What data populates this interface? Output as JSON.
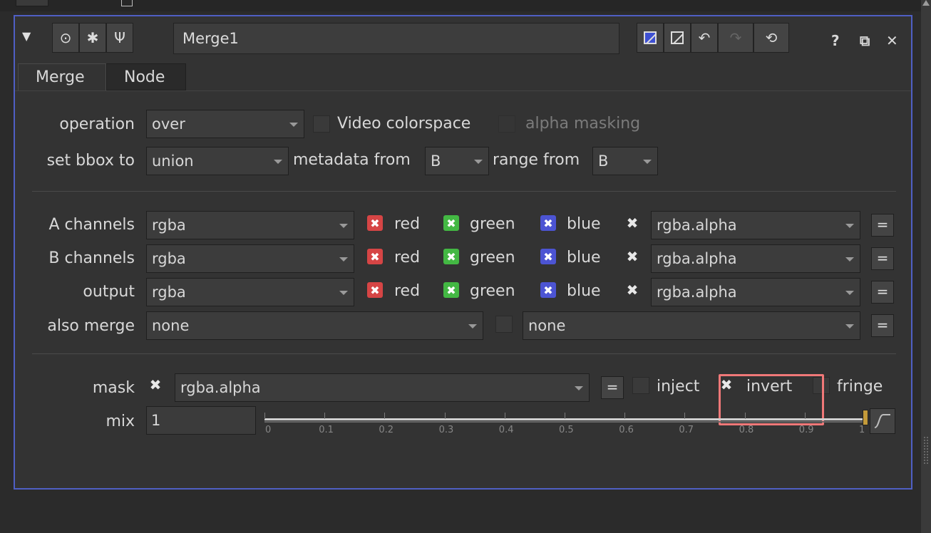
{
  "node": {
    "name": "Merge1"
  },
  "header_icons": {
    "collapse": "collapse-triangle-icon",
    "viewer": "circle-dot-icon",
    "fx": "bug-icon",
    "tools": "wrench-icon",
    "help_label": "?",
    "float_label": "⧉",
    "close_label": "✕"
  },
  "tabs": [
    {
      "label": "Merge"
    },
    {
      "label": "Node"
    }
  ],
  "row_op": {
    "label": "operation",
    "value": "over",
    "video_label": "Video colorspace",
    "alpha_label": "alpha masking"
  },
  "row_bbox": {
    "label": "set bbox to",
    "value": "union",
    "meta_label": "metadata from",
    "meta_value": "B",
    "range_label": "range from",
    "range_value": "B"
  },
  "channels": [
    {
      "label": "A channels",
      "value": "rgba",
      "red": "red",
      "green": "green",
      "blue": "blue",
      "alpha": "rgba.alpha",
      "eq": "="
    },
    {
      "label": "B channels",
      "value": "rgba",
      "red": "red",
      "green": "green",
      "blue": "blue",
      "alpha": "rgba.alpha",
      "eq": "="
    },
    {
      "label": "output",
      "value": "rgba",
      "red": "red",
      "green": "green",
      "blue": "blue",
      "alpha": "rgba.alpha",
      "eq": "="
    }
  ],
  "also_merge": {
    "label": "also merge",
    "value1": "none",
    "value2": "none",
    "eq": "="
  },
  "mask": {
    "label": "mask",
    "value": "rgba.alpha",
    "eq": "=",
    "inject": "inject",
    "invert": "invert",
    "fringe": "fringe"
  },
  "mix": {
    "label": "mix",
    "value": "1",
    "ticks": [
      "0",
      "0.1",
      "0.2",
      "0.3",
      "0.4",
      "0.5",
      "0.6",
      "0.7",
      "0.8",
      "0.9",
      "1"
    ]
  },
  "check_glyph": "✖"
}
